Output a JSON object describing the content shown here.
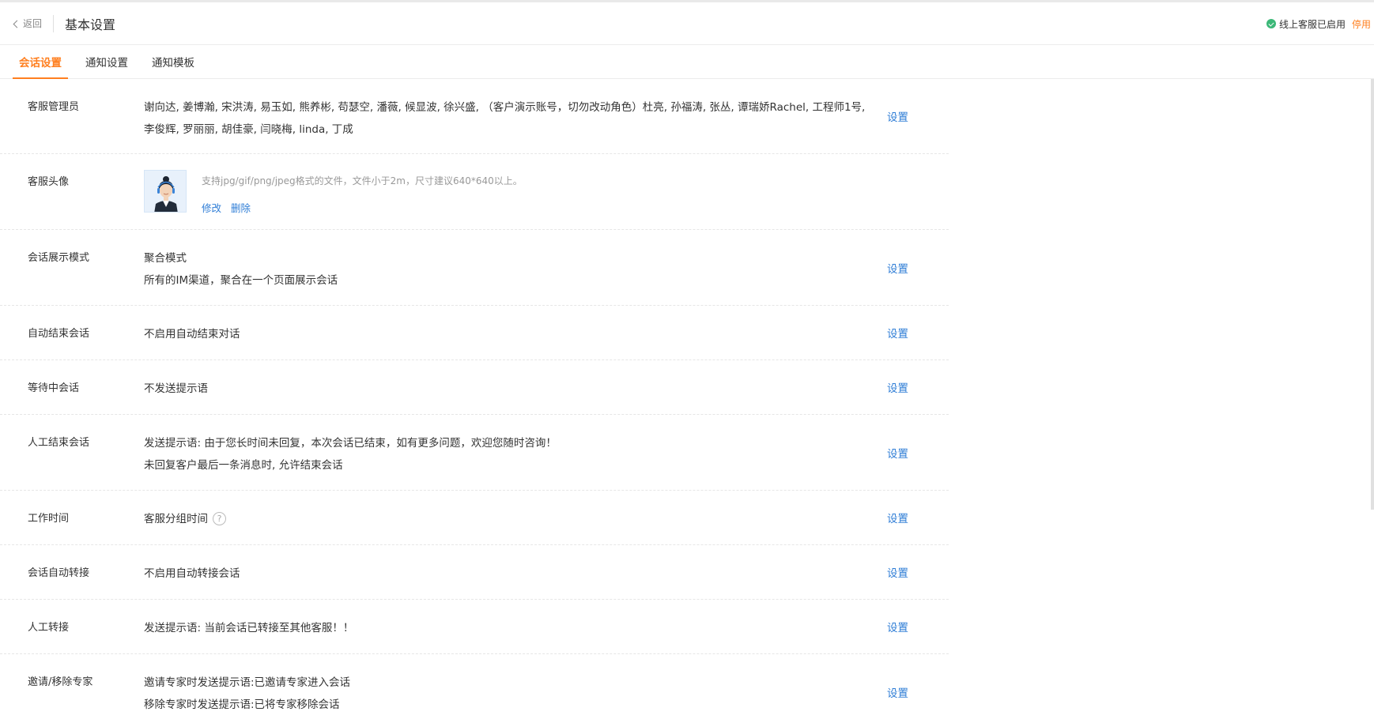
{
  "header": {
    "back_label": "返回",
    "title": "基本设置",
    "status_text": "线上客服已启用",
    "disable_label": "停用"
  },
  "tabs": [
    {
      "label": "会话设置",
      "active": true
    },
    {
      "label": "通知设置",
      "active": false
    },
    {
      "label": "通知模板",
      "active": false
    }
  ],
  "action_label": "设置",
  "rows": {
    "admins": {
      "label": "客服管理员",
      "line1": "谢向达, 姜博瀚, 宋洪涛, 易玉如, 熊养彬, 苟瑟空, 潘薇, 候显波, 徐兴盛, （客户演示账号，切勿改动角色）杜亮, 孙福涛, 张丛, 谭瑞娇Rachel, 工程师1号,",
      "line2": "李俊辉, 罗丽丽, 胡佳豪, 闫晓梅, linda, 丁成"
    },
    "avatar": {
      "label": "客服头像",
      "hint": "支持jpg/gif/png/jpeg格式的文件，文件小于2m，尺寸建议640*640以上。",
      "edit": "修改",
      "delete": "删除"
    },
    "display_mode": {
      "label": "会话展示模式",
      "line1": "聚合模式",
      "line2": "所有的IM渠道，聚合在一个页面展示会话"
    },
    "auto_end": {
      "label": "自动结束会话",
      "line1": "不启用自动结束对话"
    },
    "waiting": {
      "label": "等待中会话",
      "line1": "不发送提示语"
    },
    "manual_end": {
      "label": "人工结束会话",
      "line1": "发送提示语: 由于您长时间未回复，本次会话已结束，如有更多问题，欢迎您随时咨询！",
      "line2": "未回复客户最后一条消息时, 允许结束会话"
    },
    "work_time": {
      "label": "工作时间",
      "line1": "客服分组时间",
      "help": "?"
    },
    "auto_transfer": {
      "label": "会话自动转接",
      "line1": "不启用自动转接会话"
    },
    "manual_transfer": {
      "label": "人工转接",
      "line1": "发送提示语: 当前会话已转接至其他客服！！"
    },
    "expert": {
      "label": "邀请/移除专家",
      "line1": "邀请专家时发送提示语:已邀请专家进入会话",
      "line2": "移除专家时发送提示语:已将专家移除会话"
    }
  },
  "colors": {
    "accent": "#ff7f1f",
    "link": "#2e7dd6",
    "success": "#3cb878"
  }
}
